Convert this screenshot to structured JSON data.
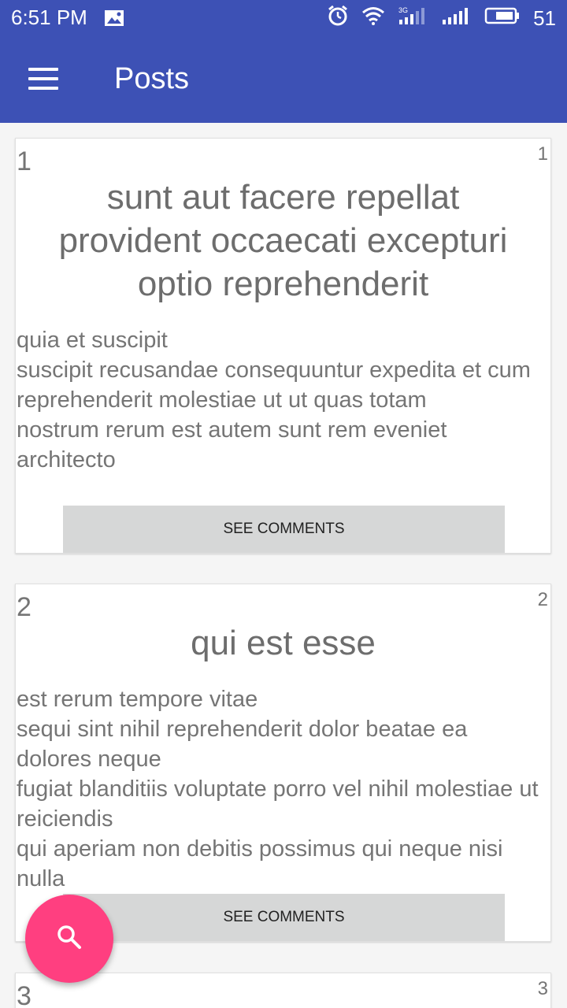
{
  "status_bar": {
    "time": "6:51 PM",
    "battery": "51",
    "network": "3G"
  },
  "app_bar": {
    "title": "Posts",
    "menu_icon": "hamburger-menu-icon"
  },
  "posts": [
    {
      "id": "1",
      "user_id": "1",
      "title": "sunt aut facere repellat provident occaecati excepturi optio reprehenderit",
      "body": "quia et suscipit\nsuscipit recusandae consequuntur expedita et cum\nreprehenderit molestiae ut ut quas totam\nnostrum rerum est autem sunt rem eveniet architecto",
      "button_label": "SEE COMMENTS"
    },
    {
      "id": "2",
      "user_id": "2",
      "title": "qui est esse",
      "body": "est rerum tempore vitae\nsequi sint nihil reprehenderit dolor beatae ea dolores neque\nfugiat blanditiis voluptate porro vel nihil molestiae ut reiciendis\nqui aperiam non debitis possimus qui neque nisi nulla",
      "button_label": "SEE COMMENTS"
    },
    {
      "id": "3",
      "user_id": "3"
    }
  ],
  "fab": {
    "icon": "search-icon",
    "color": "#ff3f80"
  },
  "colors": {
    "primary": "#3d51b5",
    "button_bg": "#d6d7d7",
    "text": "#757575"
  }
}
